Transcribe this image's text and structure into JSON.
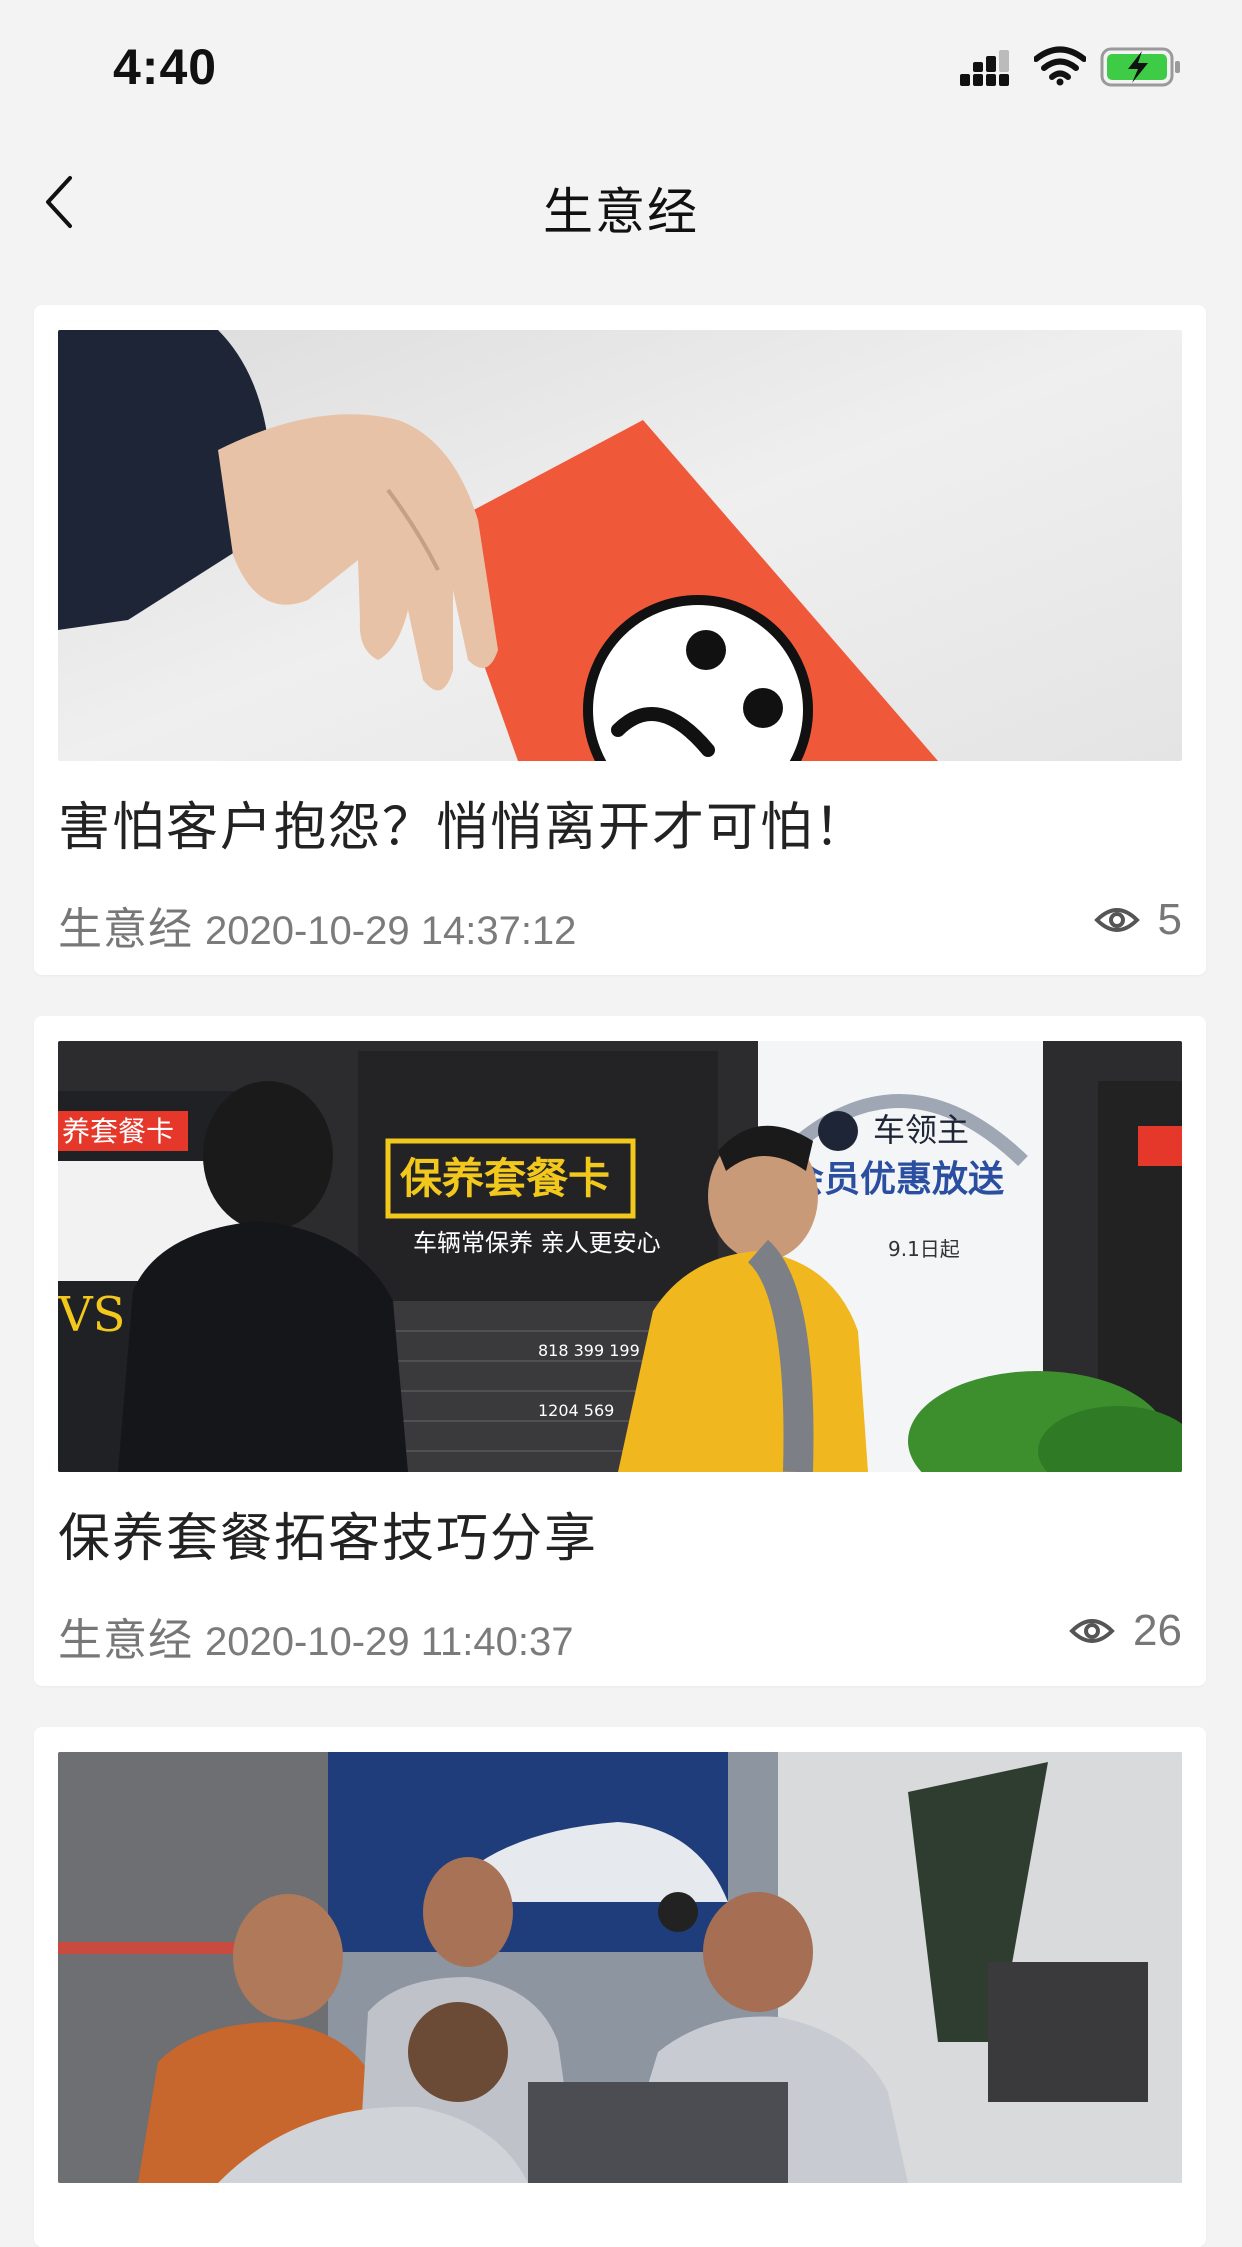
{
  "status_bar": {
    "time": "4:40"
  },
  "nav": {
    "title": "生意经"
  },
  "articles": [
    {
      "title": "害怕客户抱怨？悄悄离开才可怕！",
      "category": "生意经",
      "date": "2020-10-29 14:37:12",
      "views": "5",
      "image": {
        "poster_heading": "",
        "poster_subtitle": ""
      }
    },
    {
      "title": "保养套餐拓客技巧分享",
      "category": "生意经",
      "date": "2020-10-29 11:40:37",
      "views": "26",
      "image": {
        "poster_heading": "保养套餐卡",
        "poster_subtitle": "车辆常保养 亲人更安心",
        "left_banner": "养套餐卡",
        "right_brand": "车领主",
        "right_heading": "会员优惠放送",
        "right_note": "9.1日起"
      }
    },
    {
      "title": "",
      "category": "",
      "date": "",
      "views": "",
      "image": {}
    }
  ],
  "colors": {
    "poster_yellow": "#f2c81c",
    "red_card": "#f0583a",
    "background": "#f3f3f3"
  }
}
